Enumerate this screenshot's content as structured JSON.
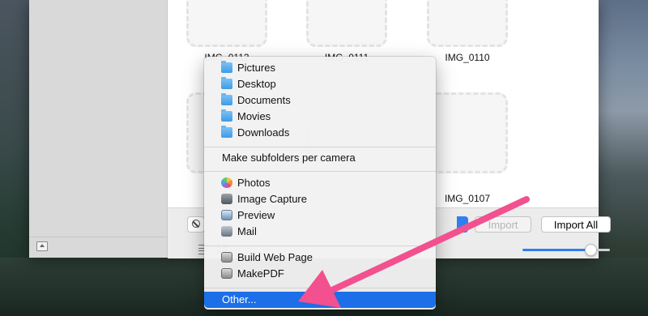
{
  "window": {
    "images": [
      {
        "label": "IMG_0112"
      },
      {
        "label": "IMG_0111"
      },
      {
        "label": "IMG_0110"
      },
      {
        "label": ""
      },
      {
        "label": ""
      },
      {
        "label": "IMG_0107"
      }
    ],
    "toolbar": {
      "import_label": "Import",
      "import_all_label": "Import All",
      "thumbnail_size_fraction": 0.78
    }
  },
  "menu": {
    "folders": [
      {
        "label": "Pictures",
        "icon": "folder-icon"
      },
      {
        "label": "Desktop",
        "icon": "folder-icon"
      },
      {
        "label": "Documents",
        "icon": "folder-icon"
      },
      {
        "label": "Movies",
        "icon": "folder-icon"
      },
      {
        "label": "Downloads",
        "icon": "folder-icon"
      }
    ],
    "subfolders_label": "Make subfolders per camera",
    "apps": [
      {
        "label": "Photos",
        "icon": "photos-icon"
      },
      {
        "label": "Image Capture",
        "icon": "image-capture-icon"
      },
      {
        "label": "Preview",
        "icon": "preview-icon"
      },
      {
        "label": "Mail",
        "icon": "mail-icon"
      }
    ],
    "workflows": [
      {
        "label": "Build Web Page",
        "icon": "automator-icon"
      },
      {
        "label": "MakePDF",
        "icon": "automator-icon"
      }
    ],
    "other_label": "Other..."
  },
  "colors": {
    "accent": "#1c6fe8",
    "annotation_arrow": "#f2508f"
  }
}
